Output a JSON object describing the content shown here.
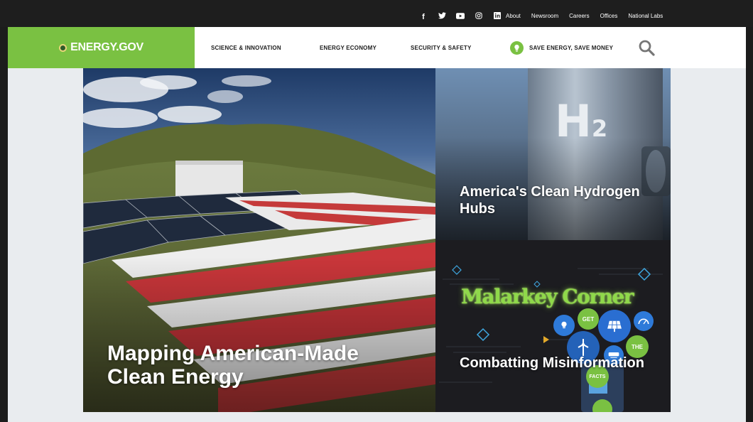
{
  "utility": {
    "social": [
      {
        "name": "facebook-icon",
        "glyph": "f"
      },
      {
        "name": "twitter-icon",
        "glyph": "🐦"
      },
      {
        "name": "youtube-icon",
        "glyph": "▶"
      },
      {
        "name": "instagram-icon",
        "glyph": "◎"
      },
      {
        "name": "linkedin-icon",
        "glyph": "in"
      }
    ],
    "links": [
      "About",
      "Newsroom",
      "Careers",
      "Offices",
      "National Labs"
    ]
  },
  "header": {
    "logo": "ENERGY.GOV",
    "nav": [
      "SCIENCE & INNOVATION",
      "ENERGY ECONOMY",
      "SECURITY & SAFETY",
      "SAVE ENERGY, SAVE MONEY"
    ],
    "accent_color": "#7ac142"
  },
  "main": {
    "hero_title": "Mapping American-Made Clean Energy",
    "tile1_title": "America's Clean Hydrogen Hubs",
    "tile1_symbol": "H",
    "tile1_subscript": "2",
    "tile2_logo": "Malarkey Corner",
    "tile2_title": "Combatting Misinformation",
    "tile2_bubbles": [
      "GET",
      "THE",
      "FACTS"
    ]
  }
}
